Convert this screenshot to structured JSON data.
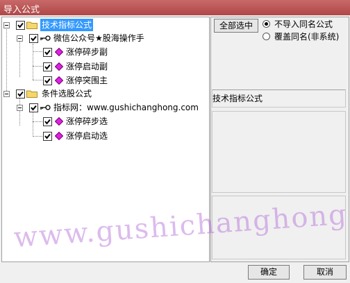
{
  "window": {
    "title": "导入公式"
  },
  "tree": {
    "root1": {
      "label": "技术指标公式"
    },
    "group1": {
      "label": "微信公众号★股海操作手"
    },
    "items1": [
      "涨停碎步副",
      "涨停启动副",
      "涨停突围主"
    ],
    "root2": {
      "label": "条件选股公式"
    },
    "group2": {
      "label": "指标网：www.gushichanghong.com"
    },
    "items2": [
      "涨停碎步选",
      "涨停启动选"
    ]
  },
  "options": {
    "select_all_label": "全部选中",
    "radio_skip_label": "不导入同名公式",
    "radio_overwrite_label": "覆盖同名(非系统)",
    "selected_radio": "radio_skip"
  },
  "info": {
    "category_text": "技术指标公式"
  },
  "buttons": {
    "ok_label": "确定",
    "cancel_label": "取消"
  },
  "watermark": {
    "text": "www.gushichanghong.com"
  },
  "colors": {
    "titlebar": "#b85858",
    "selection": "#3399ff",
    "diamond": "#e020e0"
  }
}
